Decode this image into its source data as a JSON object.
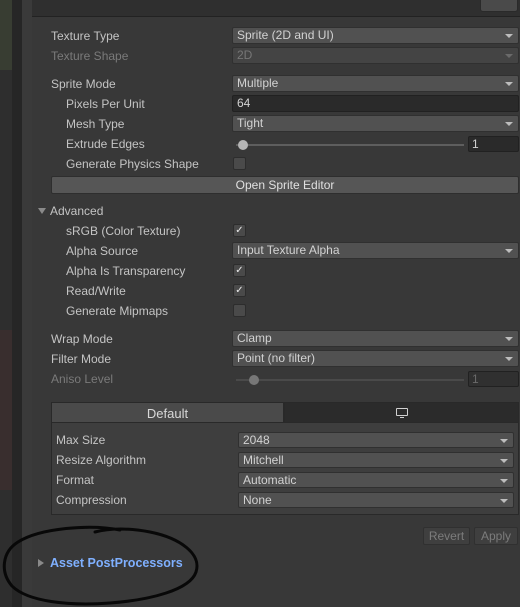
{
  "texture": {
    "texture_type": {
      "label": "Texture Type",
      "value": "Sprite (2D and UI)"
    },
    "texture_shape": {
      "label": "Texture Shape",
      "value": "2D"
    },
    "sprite_mode": {
      "label": "Sprite Mode",
      "value": "Multiple"
    },
    "pixels_per_unit": {
      "label": "Pixels Per Unit",
      "value": "64"
    },
    "mesh_type": {
      "label": "Mesh Type",
      "value": "Tight"
    },
    "extrude_edges": {
      "label": "Extrude Edges",
      "value": "1",
      "slider_fraction": 0.03
    },
    "generate_physics_shape": {
      "label": "Generate Physics Shape",
      "checked": false
    },
    "open_sprite_editor": "Open Sprite Editor"
  },
  "advanced": {
    "title": "Advanced",
    "srgb": {
      "label": "sRGB (Color Texture)",
      "checked": true
    },
    "alpha_source": {
      "label": "Alpha Source",
      "value": "Input Texture Alpha"
    },
    "alpha_is_transparency": {
      "label": "Alpha Is Transparency",
      "checked": true
    },
    "read_write": {
      "label": "Read/Write",
      "checked": true
    },
    "generate_mipmaps": {
      "label": "Generate Mipmaps",
      "checked": false
    }
  },
  "sampling": {
    "wrap_mode": {
      "label": "Wrap Mode",
      "value": "Clamp"
    },
    "filter_mode": {
      "label": "Filter Mode",
      "value": "Point (no filter)"
    },
    "aniso_level": {
      "label": "Aniso Level",
      "value": "1",
      "slider_fraction": 0.08
    }
  },
  "platform": {
    "tabs": [
      {
        "label": "Default",
        "selected": true
      },
      {
        "icon": "monitor-icon",
        "selected": false
      }
    ],
    "max_size": {
      "label": "Max Size",
      "value": "2048"
    },
    "resize_algorithm": {
      "label": "Resize Algorithm",
      "value": "Mitchell"
    },
    "format": {
      "label": "Format",
      "value": "Automatic"
    },
    "compression": {
      "label": "Compression",
      "value": "None"
    }
  },
  "actions": {
    "revert": "Revert",
    "apply": "Apply"
  },
  "footer": {
    "asset_postprocessors": "Asset PostProcessors"
  },
  "check_glyph": "✓",
  "colors": {
    "link": "#7fb0ff",
    "panel": "#383838",
    "dropdown": "#515151"
  }
}
